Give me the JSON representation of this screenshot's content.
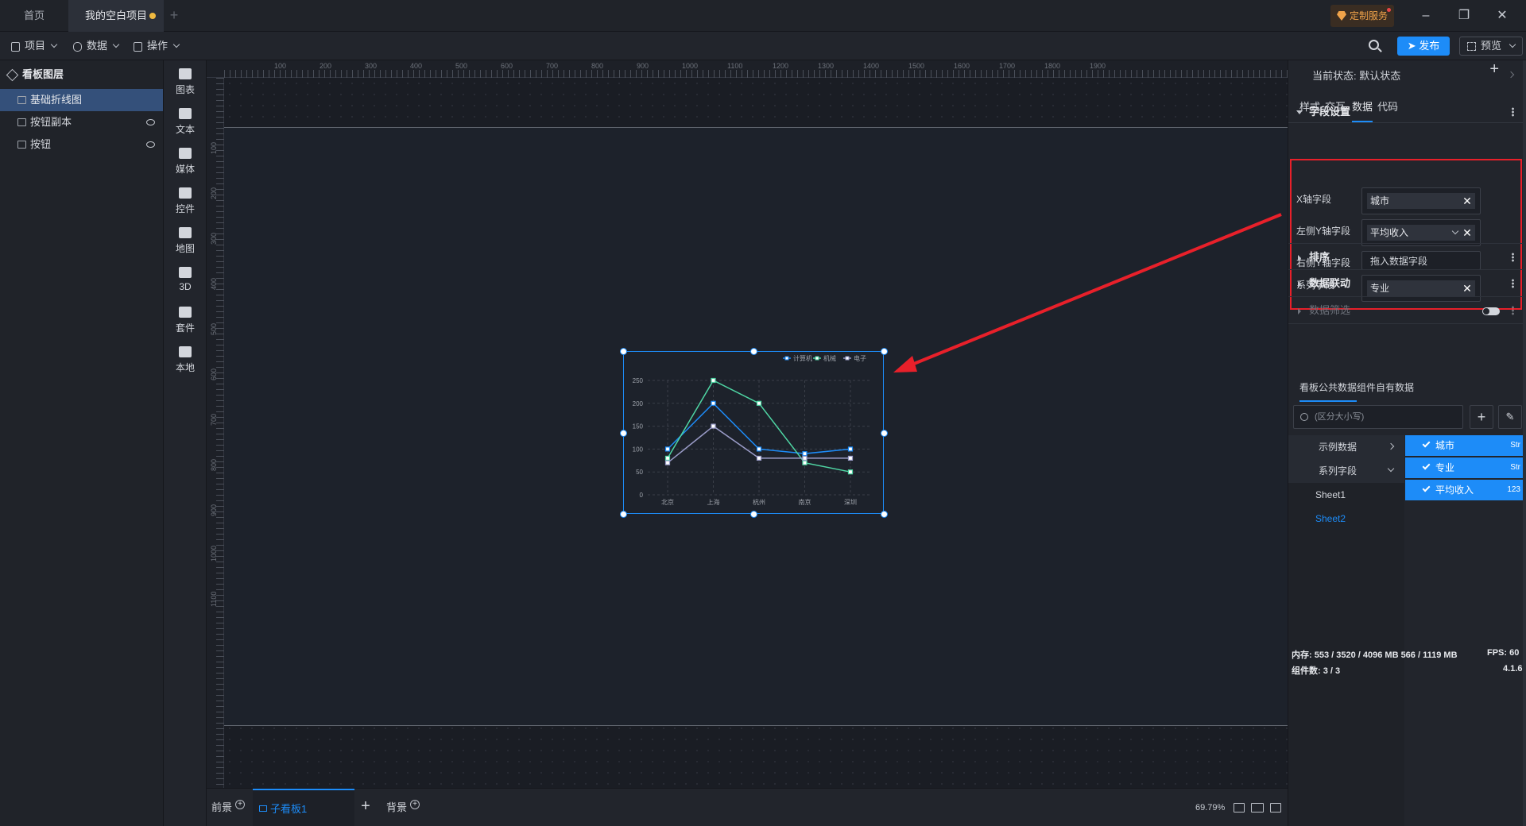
{
  "titlebar": {
    "tabs": [
      {
        "label": "首页"
      },
      {
        "label": "我的空白项目"
      }
    ],
    "custom_service": "定制服务"
  },
  "menubar": {
    "items": [
      "项目",
      "数据",
      "操作"
    ],
    "publish": "发布",
    "preview": "预览"
  },
  "layers": {
    "title": "看板图层",
    "items": [
      {
        "label": "基础折线图"
      },
      {
        "label": "按钮副本"
      },
      {
        "label": "按钮"
      }
    ]
  },
  "components": [
    "图表",
    "文本",
    "媒体",
    "控件",
    "地图",
    "3D",
    "套件",
    "本地"
  ],
  "ruler": {
    "top": [
      "100",
      "200",
      "300",
      "400",
      "500",
      "600",
      "700",
      "800",
      "900",
      "1000",
      "1100",
      "1200",
      "1300",
      "1400",
      "1500",
      "1600",
      "1700",
      "1800",
      "1900"
    ],
    "left": [
      "100",
      "200",
      "300",
      "400",
      "500",
      "600",
      "700",
      "800",
      "900",
      "1000",
      "1100"
    ]
  },
  "chart_data": {
    "type": "line",
    "categories": [
      "北京",
      "上海",
      "杭州",
      "南京",
      "深圳"
    ],
    "series": [
      {
        "name": "计算机",
        "values": [
          100,
          200,
          100,
          90,
          100
        ],
        "color": "#1d8cf8"
      },
      {
        "name": "机械",
        "values": [
          80,
          250,
          200,
          70,
          50
        ],
        "color": "#4fd6a4"
      },
      {
        "name": "电子",
        "values": [
          70,
          150,
          80,
          80,
          80
        ],
        "color": "#9a9cc8"
      }
    ],
    "ylim": [
      0,
      250
    ],
    "yticks": [
      "0",
      "50",
      "100",
      "150",
      "200",
      "250"
    ],
    "grid": true,
    "legend": "top-right"
  },
  "bottombar": {
    "foreground": "前景",
    "subboard": "子看板1",
    "background": "背景",
    "zoom": "69.79%"
  },
  "right_panel": {
    "state": "当前状态:  默认状态",
    "tabs": [
      "样式",
      "交互",
      "数据",
      "代码"
    ],
    "field_section": "字段设置",
    "fields": [
      {
        "label": "X轴字段",
        "value": "城市"
      },
      {
        "label": "左侧Y轴字段",
        "value": "平均收入"
      },
      {
        "label": "右侧Y轴字段",
        "placeholder": "拖入数据字段"
      },
      {
        "label": "系列字段",
        "value": "专业"
      }
    ],
    "sections": [
      "排序",
      "数据联动",
      "数据筛选"
    ],
    "data_tabs": [
      "看板公共数据",
      "组件自有数据"
    ],
    "search_placeholder": "(区分大小写)",
    "tree": [
      "示例数据",
      "系列字段",
      "Sheet1",
      "Sheet2"
    ],
    "columns": [
      {
        "name": "城市",
        "type": "Str"
      },
      {
        "name": "专业",
        "type": "Str"
      },
      {
        "name": "平均收入",
        "type": "123"
      }
    ],
    "status": {
      "memory": "内存:  553 / 3520 / 4096 MB  566 / 1119 MB",
      "fps": "FPS:  60",
      "count": "组件数: 3 / 3",
      "version": "4.1.6"
    }
  },
  "colors": {
    "accent": "#1d8cf8",
    "annotation": "#e8202a",
    "modified_dot": "#f0b940"
  }
}
